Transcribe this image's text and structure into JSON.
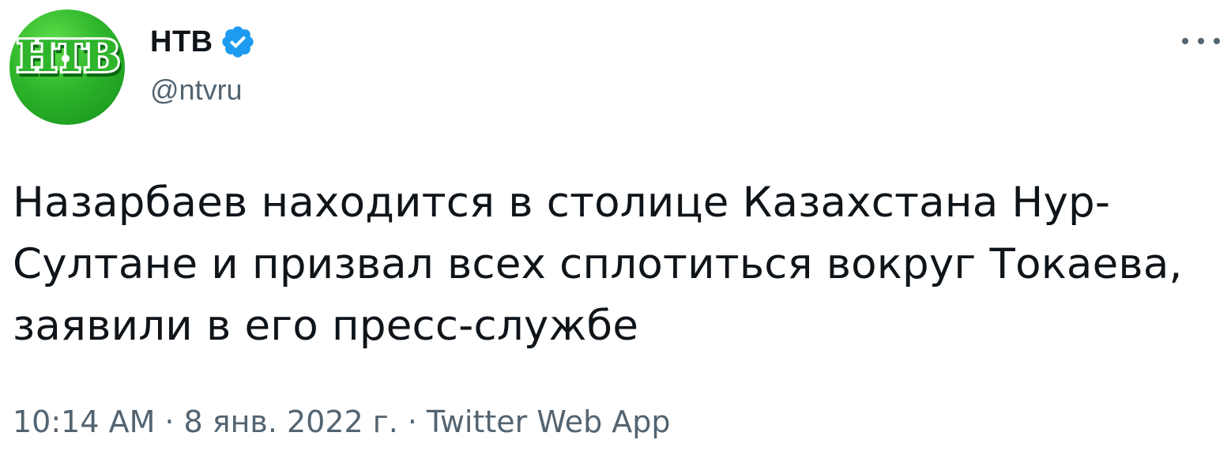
{
  "tweet": {
    "author": {
      "display_name": "НТВ",
      "handle": "@ntvru",
      "avatar_icon": "ntv-logo",
      "avatar_logo_text": "НТВ",
      "verified_icon": "verified-badge-icon",
      "verified_color": "#1d9bf0"
    },
    "more_icon": "more-options-icon",
    "text": "Назарбаев находится в столице Казахстана Нур-Султане и призвал всех сплотиться вокруг Токаева, заявили в его пресс-службе",
    "time": "10:14 AM",
    "separator": "·",
    "date": "8 янв. 2022 г.",
    "source": "Twitter Web App"
  },
  "colors": {
    "text": "#0f1419",
    "secondary": "#536471",
    "avatar_green": "#2fb52b"
  }
}
